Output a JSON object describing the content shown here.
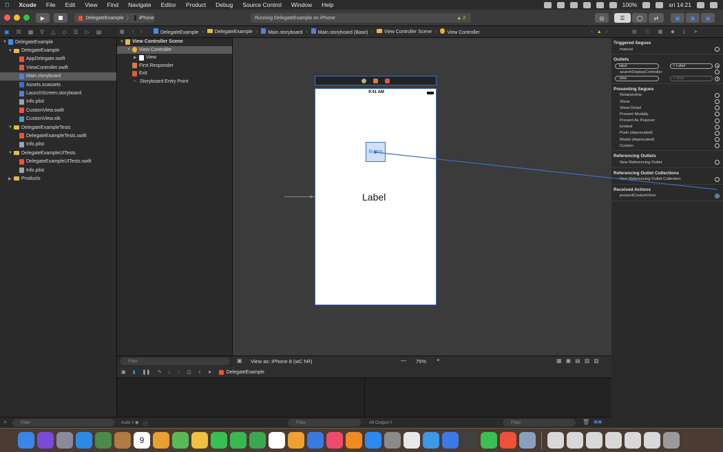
{
  "menubar": {
    "apple": "",
    "app": "Xcode",
    "items": [
      "File",
      "Edit",
      "View",
      "Find",
      "Navigate",
      "Editor",
      "Product",
      "Debug",
      "Source Control",
      "Window",
      "Help"
    ],
    "battery": "100%",
    "clock": "sri 14:21"
  },
  "toolbar": {
    "scheme": "DelegateExample",
    "device": "iPhone",
    "status": "Running DelegateExample on iPhone",
    "warnings": "2",
    "sep": "〉"
  },
  "navigator": {
    "items": [
      {
        "label": "DelegateExample",
        "icon": "proj",
        "indent": 0,
        "disclosure": "▼"
      },
      {
        "label": "DelegateExample",
        "icon": "folder",
        "indent": 1,
        "disclosure": "▼"
      },
      {
        "label": "AppDelegate.swift",
        "icon": "swift",
        "indent": 2,
        "disclosure": ""
      },
      {
        "label": "ViewController.swift",
        "icon": "swift",
        "indent": 2,
        "disclosure": ""
      },
      {
        "label": "Main.storyboard",
        "icon": "sb",
        "indent": 2,
        "disclosure": "",
        "selected": true
      },
      {
        "label": "Assets.xcassets",
        "icon": "xc",
        "indent": 2,
        "disclosure": ""
      },
      {
        "label": "LaunchScreen.storyboard",
        "icon": "sb",
        "indent": 2,
        "disclosure": ""
      },
      {
        "label": "Info.plist",
        "icon": "plist",
        "indent": 2,
        "disclosure": ""
      },
      {
        "label": "CustomView.swift",
        "icon": "swift",
        "indent": 2,
        "disclosure": ""
      },
      {
        "label": "CustomView.xib",
        "icon": "xib",
        "indent": 2,
        "disclosure": ""
      },
      {
        "label": "DelegateExampleTests",
        "icon": "folder",
        "indent": 1,
        "disclosure": "▼"
      },
      {
        "label": "DelegateExampleTests.swift",
        "icon": "swift",
        "indent": 2,
        "disclosure": ""
      },
      {
        "label": "Info.plist",
        "icon": "plist",
        "indent": 2,
        "disclosure": ""
      },
      {
        "label": "DelegateExampleUITests",
        "icon": "folder",
        "indent": 1,
        "disclosure": "▼"
      },
      {
        "label": "DelegateExampleUITests.swift",
        "icon": "swift",
        "indent": 2,
        "disclosure": ""
      },
      {
        "label": "Info.plist",
        "icon": "plist",
        "indent": 2,
        "disclosure": ""
      },
      {
        "label": "Products",
        "icon": "folder",
        "indent": 1,
        "disclosure": "▶"
      }
    ],
    "filter_placeholder": "Filter"
  },
  "jumpbar": {
    "crumbs": [
      "DelegateExample",
      "DelegateExample",
      "Main.storyboard",
      "Main.storyboard (Base)",
      "View Controller Scene",
      "View Controller"
    ]
  },
  "outline": {
    "items": [
      {
        "label": "View Controller Scene",
        "indent": 0,
        "disclosure": "▼",
        "icon": "scene",
        "bold": true
      },
      {
        "label": "View Controller",
        "indent": 1,
        "disclosure": "▼",
        "icon": "vc",
        "selected": true
      },
      {
        "label": "View",
        "indent": 2,
        "disclosure": "▶",
        "icon": "view"
      },
      {
        "label": "First Responder",
        "indent": 1,
        "disclosure": "",
        "icon": "fr"
      },
      {
        "label": "Exit",
        "indent": 1,
        "disclosure": "",
        "icon": "exit"
      },
      {
        "label": "Storyboard Entry Point",
        "indent": 1,
        "disclosure": "",
        "icon": "arrow"
      }
    ],
    "filter_placeholder": "Filter"
  },
  "canvas": {
    "time": "9:41 AM",
    "button": "Button",
    "tooltip": "Butto",
    "label": "Label"
  },
  "canvasbar": {
    "view_as": "View as: iPhone 8 (wC hR)",
    "minus": "—",
    "zoom": "75%",
    "plus": "+"
  },
  "debug": {
    "target": "DelegateExample",
    "auto": "Auto ◊",
    "filter_placeholder": "Filter",
    "all_output": "All Output ◊"
  },
  "inspector": {
    "sections": [
      {
        "title": "Triggered Segues",
        "rows": [
          {
            "label": "manual",
            "circle": "empty"
          }
        ]
      },
      {
        "title": "Outlets",
        "rows": [
          {
            "label": "label",
            "target": "× Label",
            "circle": "filled",
            "pill": true
          },
          {
            "label": "searchDisplayController",
            "circle": "empty"
          },
          {
            "label": "view",
            "target": "× View",
            "circle": "filled",
            "pill": true,
            "dim": true
          }
        ]
      },
      {
        "title": "Presenting Segues",
        "rows": [
          {
            "label": "Relationship",
            "circle": "empty"
          },
          {
            "label": "Show",
            "circle": "empty"
          },
          {
            "label": "Show Detail",
            "circle": "empty"
          },
          {
            "label": "Present Modally",
            "circle": "empty"
          },
          {
            "label": "Present As Popover",
            "circle": "empty"
          },
          {
            "label": "Embed",
            "circle": "empty"
          },
          {
            "label": "Push (deprecated)",
            "circle": "empty"
          },
          {
            "label": "Modal (deprecated)",
            "circle": "empty"
          },
          {
            "label": "Custom",
            "circle": "empty"
          }
        ]
      },
      {
        "title": "Referencing Outlets",
        "rows": [
          {
            "label": "New Referencing Outlet",
            "circle": "empty"
          }
        ]
      },
      {
        "title": "Referencing Outlet Collections",
        "rows": [
          {
            "label": "New Referencing Outlet Collection",
            "circle": "empty"
          }
        ]
      },
      {
        "title": "Received Actions",
        "rows": [
          {
            "label": "presentCustomView:",
            "circle": "blue"
          }
        ]
      }
    ]
  },
  "dock": {
    "badges": [
      "9"
    ]
  },
  "colors": {
    "accent": "#3d8ef0",
    "selection": "#5a5a5a",
    "folder": "#e8b84a"
  }
}
